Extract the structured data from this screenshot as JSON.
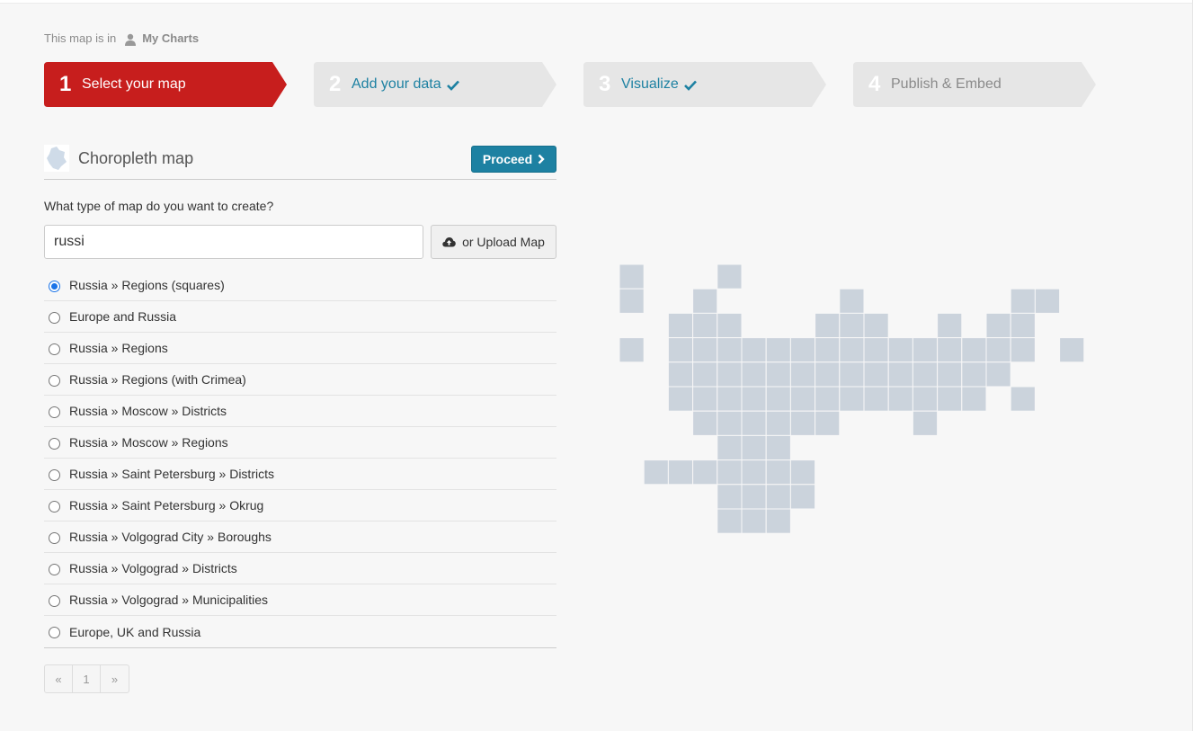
{
  "breadcrumb": {
    "prefix": "This map is in",
    "folder": "My Charts"
  },
  "steps": [
    {
      "num": "1",
      "label": "Select your map",
      "active": true,
      "done": false
    },
    {
      "num": "2",
      "label": "Add your data",
      "active": false,
      "done": true
    },
    {
      "num": "3",
      "label": "Visualize",
      "active": false,
      "done": true
    },
    {
      "num": "4",
      "label": "Publish & Embed",
      "active": false,
      "done": false
    }
  ],
  "panel": {
    "title": "Choropleth map",
    "proceed_label": "Proceed"
  },
  "question": "What type of map do you want to create?",
  "search": {
    "value": "russi"
  },
  "upload_label": "or Upload Map",
  "maps": [
    {
      "label": "Russia » Regions (squares)",
      "selected": true
    },
    {
      "label": "Europe and Russia",
      "selected": false
    },
    {
      "label": "Russia » Regions",
      "selected": false
    },
    {
      "label": "Russia » Regions (with Crimea)",
      "selected": false
    },
    {
      "label": "Russia » Moscow » Districts",
      "selected": false
    },
    {
      "label": "Russia » Moscow » Regions",
      "selected": false
    },
    {
      "label": "Russia » Saint Petersburg » Districts",
      "selected": false
    },
    {
      "label": "Russia » Saint Petersburg » Okrug",
      "selected": false
    },
    {
      "label": "Russia » Volgograd City » Boroughs",
      "selected": false
    },
    {
      "label": "Russia » Volgograd » Districts",
      "selected": false
    },
    {
      "label": "Russia » Volgograd » Municipalities",
      "selected": false
    },
    {
      "label": "Europe, UK and Russia",
      "selected": false
    }
  ],
  "pagination": {
    "prev": "«",
    "page": "1",
    "next": "»"
  },
  "colors": {
    "active_step": "#c71e1d",
    "inactive_step": "#e6e6e6",
    "accent": "#1d81a2",
    "tile": "#cbd3dc"
  },
  "icons": {
    "user": "user-icon",
    "check": "check-icon",
    "chevron": "chevron-right-icon",
    "upload": "cloud-upload-icon",
    "map_thumb": "map-thumbnail-icon"
  }
}
